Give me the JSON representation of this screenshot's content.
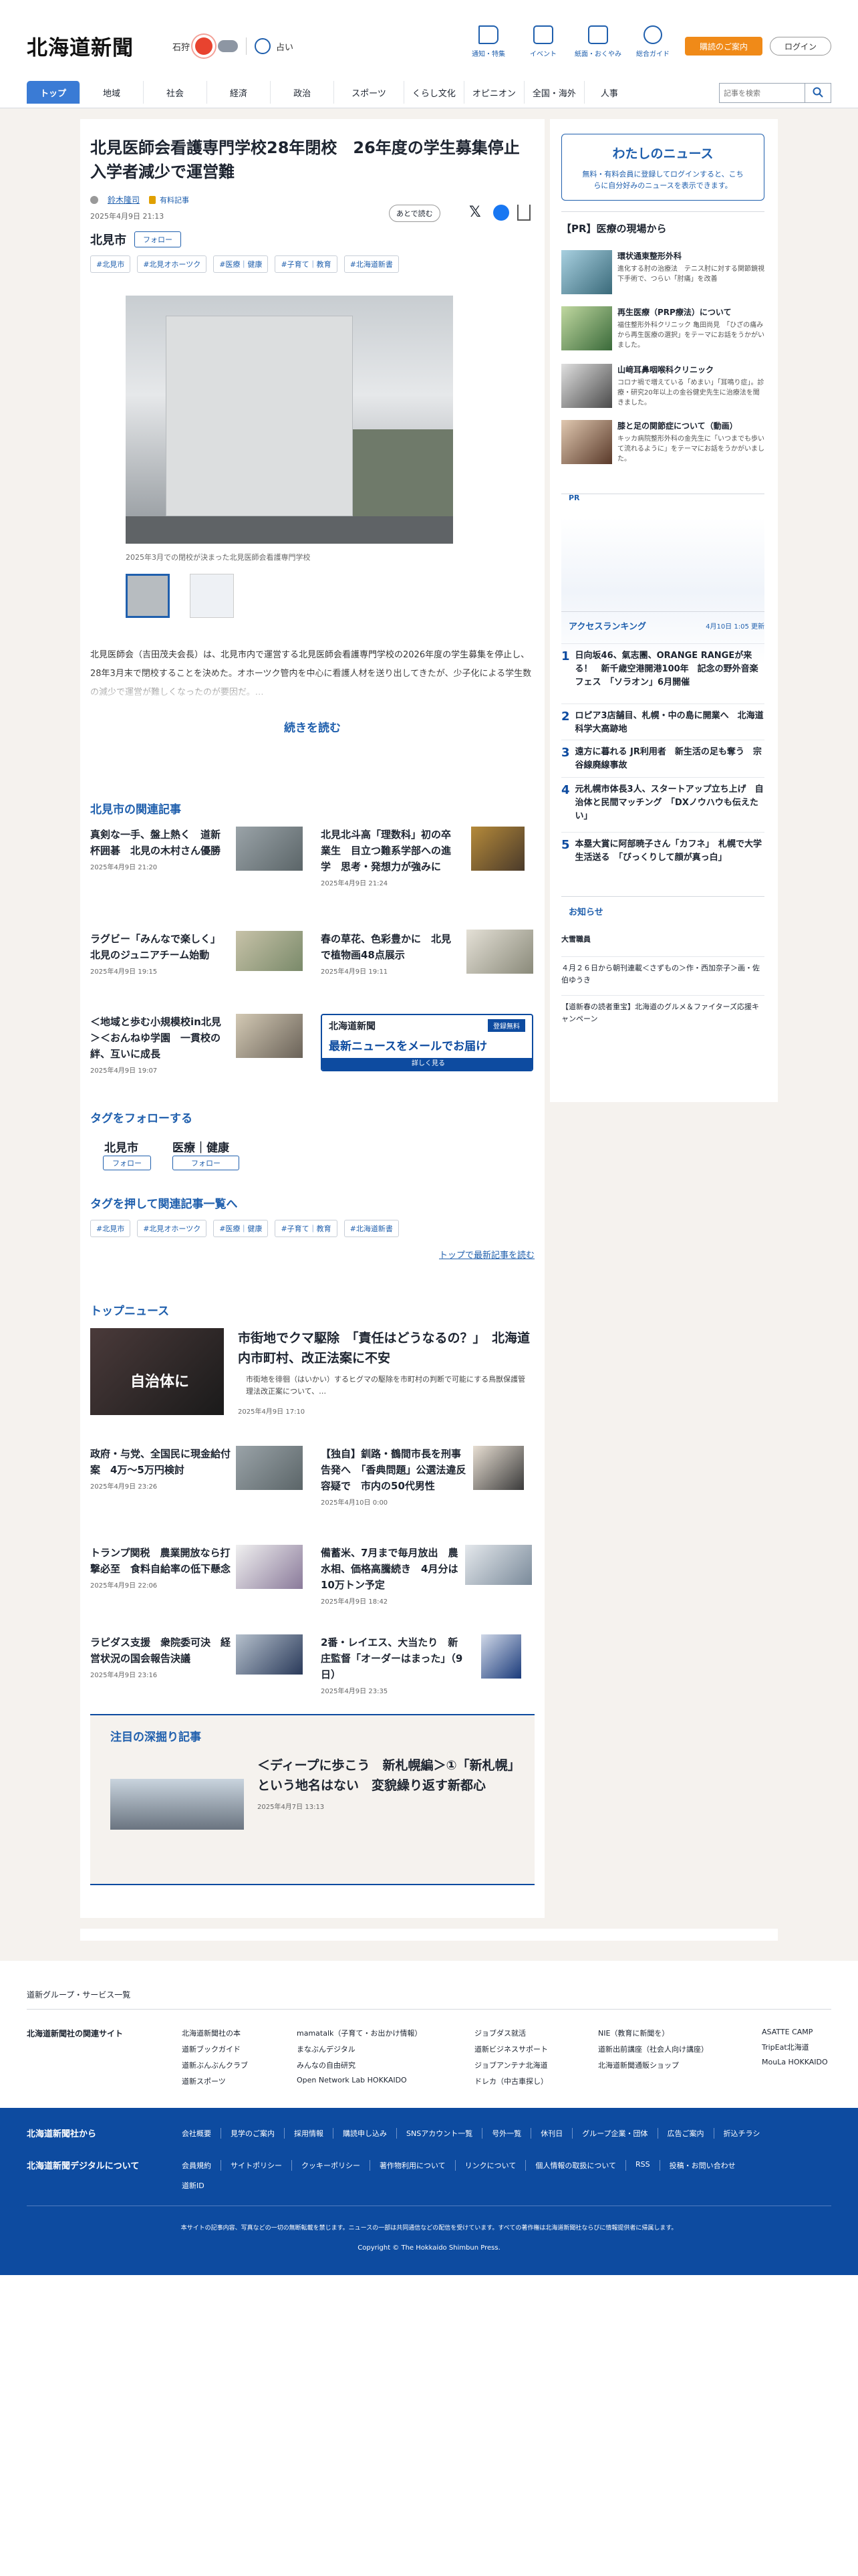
{
  "header": {
    "logo": "北海道新聞",
    "weather_city": "石狩",
    "fortune": "占い",
    "util": [
      "通知・特集",
      "イベント",
      "紙面・おくやみ",
      "総合ガイド"
    ],
    "subscribe": "購読のご案内",
    "login": "ログイン",
    "search_placeholder": "記事を検索"
  },
  "nav": [
    "トップ",
    "地域",
    "社会",
    "経済",
    "政治",
    "スポーツ",
    "くらし文化",
    "オピニオン",
    "全国・海外",
    "人事"
  ],
  "article": {
    "title": "北見医師会看護専門学校28年閉校　26年度の学生募集停止　入学者減少で運営難",
    "author": "鈴木隆司",
    "paid": "有料記事",
    "date": "2025年4月9日 21:13",
    "later": "あとで読む",
    "region": "北見市",
    "follow": "フォロー",
    "tags": [
      "#北見市",
      "#北見オホーツク",
      "#医療｜健康",
      "#子育て｜教育",
      "#北海道新書"
    ],
    "caption": "2025年3月での閉校が決まった北見医師会看護専門学校",
    "body": "北見医師会（吉田茂夫会長）は、北見市内で運営する北見医師会看護専門学校の2026年度の学生募集を停止し、28年3月末で閉校することを決めた。オホーツク管内を中心に看護人材を送り出してきたが、少子化による学生数の減少で運営が難しくなったのが要因だ。…",
    "read_more": "続きを読む"
  },
  "related": {
    "heading": "北見市の関連記事",
    "items": [
      {
        "title": "真剣な一手、盤上熱く　道新杯囲碁　北見の木村さん優勝",
        "date": "2025年4月9日 21:20"
      },
      {
        "title": "北見北斗高「理数科」初の卒業生　目立つ難系学部への進学　思考・発想力が強みに",
        "date": "2025年4月9日 21:24"
      },
      {
        "title": "ラグビー「みんなで楽しく」　北見のジュニアチーム始動",
        "date": "2025年4月9日 19:15"
      },
      {
        "title": "春の草花、色彩豊かに　北見で植物画48点展示",
        "date": "2025年4月9日 19:11"
      },
      {
        "title": "＜地域と歩む小規模校in北見＞＜おんねゆ学園　一貫校の絆、互いに成長",
        "date": "2025年4月9日 19:07"
      }
    ],
    "banner_logo": "北海道新聞",
    "banner_free": "登録無料",
    "banner_title": "最新ニュースをメールでお届け",
    "banner_more": "詳しく見る"
  },
  "follow_tags": {
    "heading": "タグをフォローする",
    "items": [
      "北見市",
      "医療｜健康"
    ],
    "follow": "フォロー"
  },
  "tag_links": {
    "heading": "タグを押して関連記事一覧へ",
    "tags": [
      "#北見市",
      "#北見オホーツク",
      "#医療｜健康",
      "#子育て｜教育",
      "#北海道新書"
    ],
    "latest": "トップで最新記事を読む"
  },
  "top_news": {
    "heading": "トップニュース",
    "lead_title": "市街地でクマ駆除　「責任はどうなるの？」　北海道内市町村、改正法案に不安",
    "lead_body": "市街地を徘徊（はいかい）するヒグマの駆除を市町村の判断で可能にする鳥獣保護管理法改正案について、…",
    "lead_date": "2025年4月9日 17:10",
    "lead_thumb_text": "自治体に",
    "items": [
      {
        "title": "政府・与党、全国民に現金給付案　4万～5万円検討",
        "date": "2025年4月9日 23:26"
      },
      {
        "title": "【独自】釧路・鶴間市長を刑事告発へ　「香典問題」公選法違反容疑で　市内の50代男性",
        "date": "2025年4月10日 0:00"
      },
      {
        "title": "トランプ関税　農業開放なら打撃必至　食料自給率の低下懸念",
        "date": "2025年4月9日 22:06"
      },
      {
        "title": "備蓄米、7月まで毎月放出　農水相、価格高騰続き　4月分は10万トン予定",
        "date": "2025年4月9日 18:42"
      },
      {
        "title": "ラピダス支援　衆院委可決　経営状況の国会報告決議",
        "date": "2025年4月9日 23:16"
      },
      {
        "title": "2番・レイエス、大当たり　新庄監督「オーダーはまった」（9日）",
        "date": "2025年4月9日 23:35"
      }
    ]
  },
  "deep": {
    "heading": "注目の深掘り記事",
    "title": "＜ディープに歩こう　新札幌編＞①「新札幌」という地名はない　変貌繰り返す新都心",
    "date": "2025年4月7日 13:13"
  },
  "sidebar": {
    "my_news_title": "わたしのニュース",
    "my_news_body": "無料・有料会員に登録してログインすると、こちらに自分好みのニュースを表示できます。",
    "pr_heading": "【PR】医療の現場から",
    "pr_items": [
      {
        "title": "環状通東整形外科",
        "desc": "進化する肘の治療法　テニス肘に対する関節鏡視下手術で、つらい「肘痛」を改善"
      },
      {
        "title": "再生医療（PRP療法）について",
        "desc": "福住整形外科クリニック 亀田尚見　「ひざの痛みから再生医療の選択」をテーマにお話をうかがいました。"
      },
      {
        "title": "山﨑耳鼻咽喉科クリニック",
        "desc": "コロナ禍で増えている「めまい」「耳鳴り症」。診療・研究20年以上の金谷健史先生に治療法を聞きました。"
      },
      {
        "title": "膝と足の関節症について（動画）",
        "desc": "キッカ病院整形外科の金先生に「いつまでも歩いて流れるように」をテーマにお話をうかがいました。"
      }
    ],
    "pr_label": "PR",
    "ranking_heading": "アクセスランキング",
    "ranking_time": "4月10日 1:05 更新",
    "ranking": [
      {
        "n": "1",
        "title": "日向坂46、氣志團、ORANGE RANGEが来る！　新千歳空港開港100年　記念の野外音楽フェス　「ソラオン」6月開催"
      },
      {
        "n": "2",
        "title": "ロピア3店舗目、札幌・中の島に開業へ　北海道科学大高跡地"
      },
      {
        "n": "3",
        "title": "遠方に暮れる JR利用者　新生活の足も奪う　宗谷線廃線事故"
      },
      {
        "n": "4",
        "title": "元札幌市体長3人、スタートアップ立ち上げ　自治体と民間マッチング　「DXノウハウも伝えたい」"
      },
      {
        "n": "5",
        "title": "本塁大賞に阿部暁子さん「カフネ」　札幌で大学生活送る　「びっくりして顔が真っ白」"
      }
    ],
    "notice_heading": "お知らせ",
    "notice_items": [
      {
        "tag": "大雪職員",
        "text": "４月２６日から朝刊連載＜さずもの＞作・西加奈子＞画・佐伯ゆうき"
      },
      {
        "tag": "",
        "text": "【道新春の読者重宝】北海道のグルメ＆ファイターズ応援キャンペーン"
      }
    ]
  },
  "footer": {
    "group_link": "道新グループ・サービス一覧",
    "related_sites_label": "北海道新聞社の関連サイト",
    "columns": [
      [
        "北海道新聞社の本",
        "道新ブックガイド",
        "道新ぶんぶんクラブ",
        "道新スポーツ"
      ],
      [
        "mamatalk（子育て・お出かけ情報）",
        "まなぶんデジタル",
        "みんなの自由研究",
        "Open Network Lab HOKKAIDO"
      ],
      [
        "ジョブダス就活",
        "道新ビジネスサポート",
        "ジョブアンテナ北海道",
        "ドレカ（中古車探し）"
      ],
      [
        "NIE（教育に新聞を）",
        "道新出前講座（社会人向け講座）",
        "北海道新聞通販ショップ"
      ],
      [
        "ASATTE CAMP",
        "TripEat北海道",
        "MouLa HOKKAIDO"
      ]
    ],
    "company_label": "北海道新聞社から",
    "digital_label": "北海道新聞デジタルについて",
    "company_links": [
      "会社概要",
      "見学のご案内",
      "採用情報",
      "購読申し込み",
      "SNSアカウント一覧",
      "号外一覧",
      "休刊日",
      "グループ企業・団体",
      "広告ご案内",
      "折込チラシ"
    ],
    "digital_links": [
      "会員規約",
      "サイトポリシー",
      "クッキーポリシー",
      "著作物利用について",
      "リンクについて",
      "個人情報の取扱について",
      "RSS",
      "投稿・お問い合わせ",
      "道新ID"
    ],
    "notice": "本サイトの記事内容、写真などの一切の無断転載を禁じます。ニュースの一部は共同通信などの配信を受けています。すべての著作権は北海道新聞社ならびに情報提供者に帰属します。",
    "copyright": "Copyright © The Hokkaido Shimbun Press."
  }
}
